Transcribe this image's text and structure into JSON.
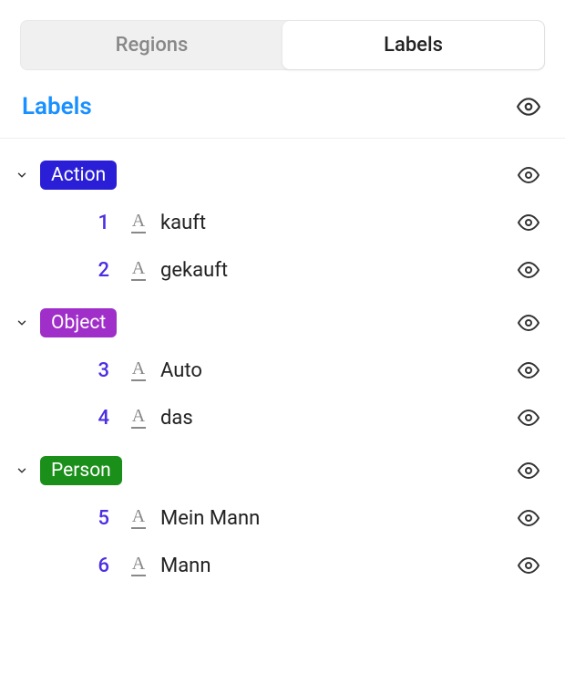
{
  "tabs": {
    "regions": "Regions",
    "labels": "Labels",
    "active": "labels"
  },
  "section": {
    "title": "Labels"
  },
  "groups": [
    {
      "name": "Action",
      "color": "#2a1fd6",
      "items": [
        {
          "index": "1",
          "text": "kauft"
        },
        {
          "index": "2",
          "text": "gekauft"
        }
      ]
    },
    {
      "name": "Object",
      "color": "#a02fc9",
      "items": [
        {
          "index": "3",
          "text": "Auto"
        },
        {
          "index": "4",
          "text": "das"
        }
      ]
    },
    {
      "name": "Person",
      "color": "#1a8f1a",
      "items": [
        {
          "index": "5",
          "text": "Mein Mann"
        },
        {
          "index": "6",
          "text": "Mann"
        }
      ]
    }
  ]
}
